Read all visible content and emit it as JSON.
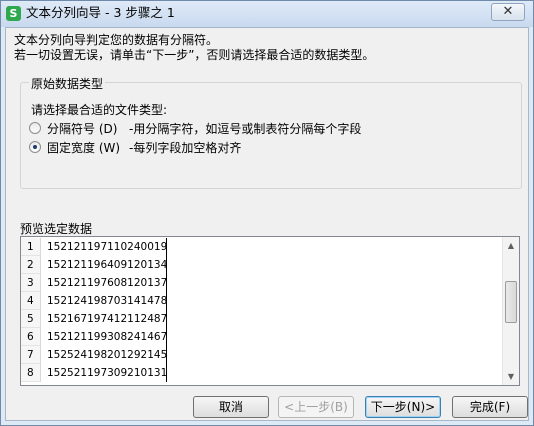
{
  "window": {
    "title": "文本分列向导 - 3 步骤之 1",
    "app_icon": "S",
    "close_label": "✕"
  },
  "intro": {
    "line1": "文本分列向导判定您的数据有分隔符。",
    "line2": "若一切设置无误，请单击“下一步”，否则请选择最合适的数据类型。"
  },
  "original_type": {
    "title": "原始数据类型",
    "prompt": "请选择最合适的文件类型:",
    "options": [
      {
        "label": "分隔符号 (D)",
        "desc": "-用分隔字符，如逗号或制表符分隔每个字段",
        "checked": false
      },
      {
        "label": "固定宽度 (W)",
        "desc": "-每列字段加空格对齐",
        "checked": true
      }
    ]
  },
  "preview": {
    "label": "预览选定数据",
    "rows": [
      {
        "num": "1",
        "value": "152121197110240019"
      },
      {
        "num": "2",
        "value": "152121196409120134"
      },
      {
        "num": "3",
        "value": "152121197608120137"
      },
      {
        "num": "4",
        "value": "152124198703141478"
      },
      {
        "num": "5",
        "value": "152167197412112487"
      },
      {
        "num": "6",
        "value": "152121199308241467"
      },
      {
        "num": "7",
        "value": "152524198201292145"
      },
      {
        "num": "8",
        "value": "152521197309210131"
      }
    ]
  },
  "buttons": {
    "cancel": "取消",
    "back": "<上一步(B)",
    "next": "下一步(N)>",
    "finish": "完成(F)"
  },
  "colors": {
    "title_bar": "#c8d9ee",
    "dialog_bg": "#f0f0f0"
  }
}
